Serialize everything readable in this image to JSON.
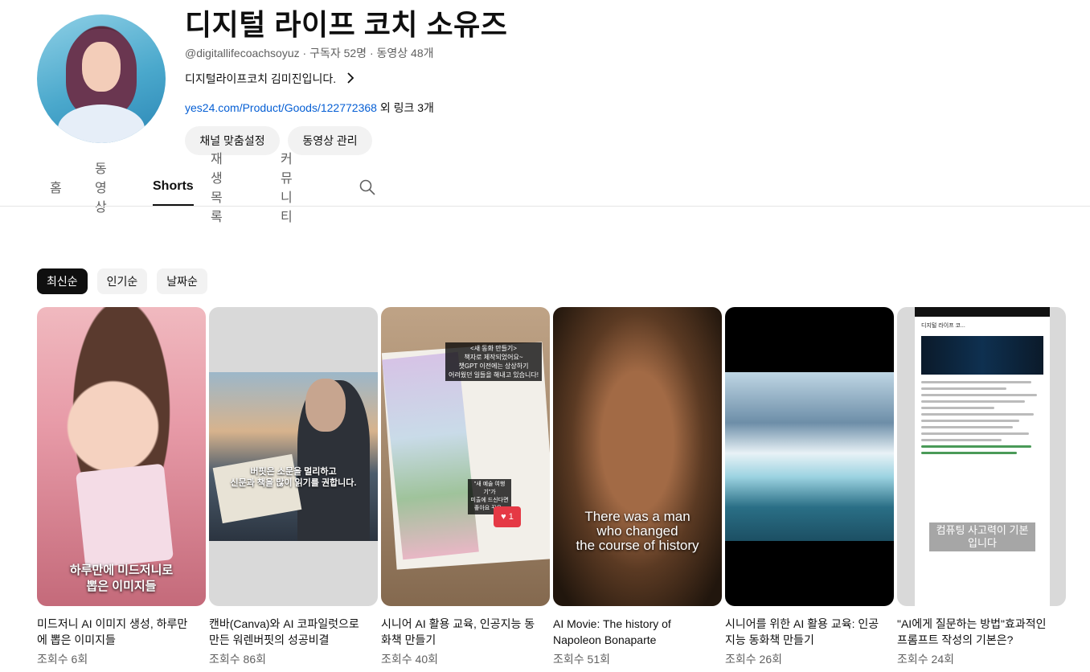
{
  "channel": {
    "name": "디지털 라이프 코치 소유즈",
    "handle": "@digitallifecoachsoyuz",
    "subscribers": "구독자 52명",
    "video_count": "동영상 48개",
    "separator": " · ",
    "description": "디지털라이프코치 김미진입니다.",
    "link_url": "yes24.com/Product/Goods/122772368",
    "link_more": " 외 링크 3개"
  },
  "buttons": {
    "customize": "채널 맞춤설정",
    "manage": "동영상 관리"
  },
  "tabs": {
    "home": "홈",
    "videos": "동영상",
    "shorts": "Shorts",
    "playlists": "재생목록",
    "community": "커뮤니티"
  },
  "sort_chips": [
    "최신순",
    "인기순",
    "날짜순"
  ],
  "shorts": [
    {
      "title": "미드저니 AI 이미지 생성, 하루만에 뽑은 이미지들",
      "views": "조회수 6회",
      "overlay": "하루만에 미드저니로\n뽑은 이미지들"
    },
    {
      "title": "캔바(Canva)와 AI 코파일럿으로 만든 워렌버핏의 성공비결",
      "views": "조회수 86회",
      "overlay": "버핏은 소문을 멀리하고\n신문과 책을 많이 읽기를 권합니다."
    },
    {
      "title": "시니어 AI 활용 교육, 인공지능 동화책 만들기",
      "views": "조회수 40회",
      "overlay": "<새 동화 만들기>\n책자로 제작되었어요~\n챗GPT 이전에는 상상하기\n어려웠던 일들을 해내고 있습니다!",
      "overlay2": "\"새 예술 여행기\"가\n미출에 드신다면\n좋아요 꾸우~",
      "like_count": "1"
    },
    {
      "title": "AI Movie: The history of Napoleon Bonaparte",
      "views": "조회수 51회",
      "overlay": "There was a man\nwho changed\nthe course of history"
    },
    {
      "title": "시니어를 위한 AI 활용 교육: 인공지능 동화책 만들기",
      "views": "조회수 26회",
      "overlay": ""
    },
    {
      "title": "\"AI에게 질문하는 방법\"효과적인 프롬프트 작성의 기본은?",
      "views": "조회수 24회",
      "overlay": "컴퓨팅 사고력이 기본\n입니다",
      "phone_title": "디지털 라이프 코..."
    }
  ],
  "colors": {
    "link": "#065fd4",
    "chip_active": "#0f0f0f",
    "chip": "#f2f2f2",
    "secondary_text": "#606060"
  },
  "icons": [
    "search-icon",
    "chevron-right-icon",
    "heart-icon"
  ]
}
